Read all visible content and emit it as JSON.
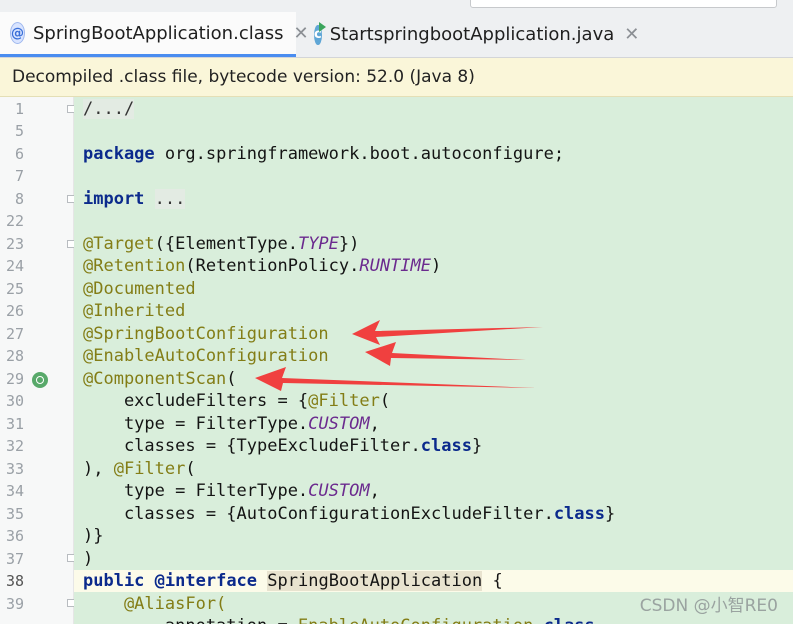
{
  "tabs": [
    {
      "label": "SpringBootApplication.class",
      "icon": "annotation-class-icon",
      "active": true
    },
    {
      "label": "StartspringbootApplication.java",
      "icon": "java-class-run-icon",
      "active": false
    }
  ],
  "banner": "Decompiled .class file, bytecode version: 52.0 (Java 8)",
  "line_numbers": [
    "1",
    "5",
    "6",
    "7",
    "8",
    "22",
    "23",
    "24",
    "25",
    "26",
    "27",
    "28",
    "29",
    "30",
    "31",
    "32",
    "33",
    "34",
    "35",
    "36",
    "37",
    "38",
    "39"
  ],
  "code": {
    "l1": "/.../",
    "l6_kw": "package",
    "l6_rest": " org.springframework.boot.autoconfigure;",
    "l8_kw": "import",
    "l8_fold": "...",
    "l23_a": "@Target",
    "l23_b": "({ElementType.",
    "l23_c": "TYPE",
    "l23_d": "})",
    "l24_a": "@Retention",
    "l24_b": "(RetentionPolicy.",
    "l24_c": "RUNTIME",
    "l24_d": ")",
    "l25": "@Documented",
    "l26": "@Inherited",
    "l27": "@SpringBootConfiguration",
    "l28": "@EnableAutoConfiguration",
    "l29_a": "@ComponentScan",
    "l29_b": "(",
    "l30_a": "    excludeFilters = {",
    "l30_b": "@Filter",
    "l30_c": "(",
    "l31_a": "    type = FilterType.",
    "l31_b": "CUSTOM",
    "l31_c": ",",
    "l32_a": "    classes = {TypeExcludeFilter.",
    "l32_b": "class",
    "l32_c": "}",
    "l33_a": "), ",
    "l33_b": "@Filter",
    "l33_c": "(",
    "l34_a": "    type = FilterType.",
    "l34_b": "CUSTOM",
    "l34_c": ",",
    "l35_a": "    classes = {AutoConfigurationExcludeFilter.",
    "l35_b": "class",
    "l35_c": "}",
    "l36": ")}",
    "l37": ")",
    "l38_a": "public",
    "l38_b": " ",
    "l38_c": "@interface",
    "l38_d": " ",
    "l38_e": "SpringBootApplication",
    "l38_f": " {",
    "l39": "    @AliasFor(",
    "l40_a": "        annotation = ",
    "l40_b": "EnableAutoConfiguration",
    "l40_c": ".",
    "l40_d": "class"
  },
  "watermark": "CSDN @小智RE0",
  "colors": {
    "arrow": "#f0403f",
    "background": "#d9eedb"
  }
}
